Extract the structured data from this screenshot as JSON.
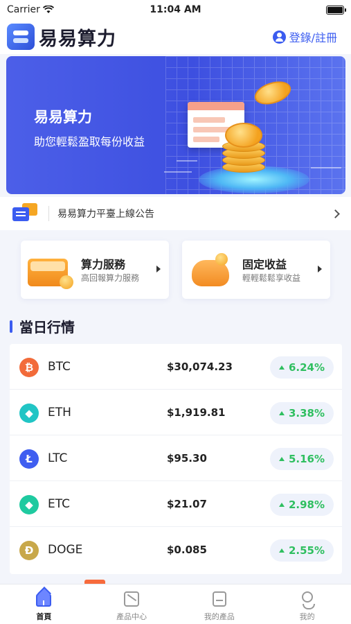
{
  "status_bar": {
    "carrier": "Carrier",
    "time": "11:04 AM"
  },
  "header": {
    "logo_text": "易易算力",
    "login_label": "登錄/註冊"
  },
  "banner": {
    "title": "易易算力",
    "subtitle": "助您輕鬆盈取每份收益"
  },
  "notice": {
    "text": "易易算力平臺上線公告"
  },
  "services": [
    {
      "title": "算力服務",
      "subtitle": "高回報算力服務"
    },
    {
      "title": "固定收益",
      "subtitle": "輕輕鬆鬆享收益"
    }
  ],
  "market": {
    "title": "當日行情",
    "rows": [
      {
        "symbol": "BTC",
        "price": "$30,074.23",
        "change": "6.24%",
        "icon_glyph": "₿",
        "icon_color": "#f26b3a"
      },
      {
        "symbol": "ETH",
        "price": "$1,919.81",
        "change": "3.38%",
        "icon_glyph": "◆",
        "icon_color": "#21c5c5"
      },
      {
        "symbol": "LTC",
        "price": "$95.30",
        "change": "5.16%",
        "icon_glyph": "Ł",
        "icon_color": "#3f5ef0"
      },
      {
        "symbol": "ETC",
        "price": "$21.07",
        "change": "2.98%",
        "icon_glyph": "◆",
        "icon_color": "#1fcaa0"
      },
      {
        "symbol": "DOGE",
        "price": "$0.085",
        "change": "2.55%",
        "icon_glyph": "Ð",
        "icon_color": "#c8a84a"
      }
    ]
  },
  "tabs": [
    {
      "label": "首頁",
      "icon": "home-icon"
    },
    {
      "label": "產品中心",
      "icon": "product-center-icon"
    },
    {
      "label": "我的產品",
      "icon": "my-products-icon"
    },
    {
      "label": "我的",
      "icon": "profile-icon"
    }
  ],
  "colors": {
    "accent": "#3b5cf0",
    "up": "#2fbf60",
    "orange": "#f5a623"
  }
}
